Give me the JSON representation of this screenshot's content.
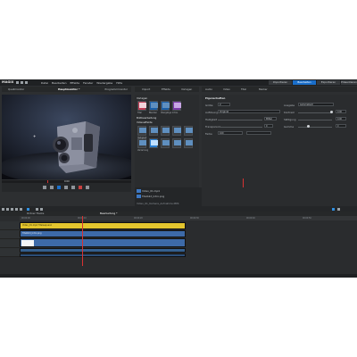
{
  "app": {
    "logo": "MAGIX",
    "menu": [
      "Datei",
      "Bearbeiten",
      "Effekte",
      "Fenster",
      "Wiedergabe",
      "Hilfe"
    ],
    "tabs": [
      {
        "label": "Importieren",
        "active": false
      },
      {
        "label": "Bearbeiten",
        "active": true
      },
      {
        "label": "Exportieren",
        "active": false
      },
      {
        "label": "Präsentieren",
        "active": false
      }
    ]
  },
  "preview": {
    "left_label": "Quellmonitor",
    "title": "Hauptmonitor *",
    "right_label": "Programmmonitor",
    "timecode": "0:00"
  },
  "effects_panel": {
    "tabs": [
      "Import",
      "Effekte",
      "Vorlagen"
    ],
    "section1": "Vorlagen",
    "section1_items": [
      "Titel",
      "Blenden",
      "Übergänge",
      "Intros"
    ],
    "section2": "Bildbearbeitung",
    "section3": "Videoeffekte",
    "section3_items": [
      "Helligkeit",
      "Farbe",
      "Schärfe",
      "Bewegung",
      "Stabilisierung",
      "Verzerrung",
      "Schatten",
      "Spiegelung",
      "Alpha",
      "Chroma"
    ]
  },
  "properties_panel": {
    "tabs": [
      "Audio",
      "Video",
      "Titel",
      "Marker"
    ],
    "header": "Eigenschaften",
    "rows": [
      {
        "label": "Größe",
        "value": "2"
      },
      {
        "label": "Auflösung",
        "value": "Original"
      },
      {
        "label": "Helligkeit",
        "value": "Mittel"
      },
      {
        "label": "Transparenz",
        "value": "0"
      },
      {
        "label": "Farbe",
        "value": "100"
      }
    ],
    "right_rows": [
      {
        "label": "Ausgabe",
        "value": "Automatisch"
      },
      {
        "label": "Kontrast",
        "value": "0.00"
      },
      {
        "label": "Sättigung",
        "value": "0.00"
      },
      {
        "label": "Gamma",
        "value": "0"
      }
    ]
  },
  "media": {
    "items": [
      "Video_01.mp4",
      "Titelbild_Intro.png"
    ],
    "path_label": "Video_01_Kamera_Aufnahme.MP4"
  },
  "timeline": {
    "tab_left": "Ordner Tracks",
    "tab_center": "Bearbeitung *",
    "clip_title": "Video_01.mp4  Titelsequenz",
    "clip_sub": "Titelbild_Intro.png",
    "ruler": [
      "00:00:00",
      "00:00:10",
      "00:00:20",
      "00:00:30",
      "00:00:40",
      "00:00:50"
    ]
  },
  "colors": {
    "accent": "#1a6ec9",
    "clip_yellow": "#e3c52e",
    "clip_blue": "#3d6aa8",
    "playhead": "#d83232"
  }
}
